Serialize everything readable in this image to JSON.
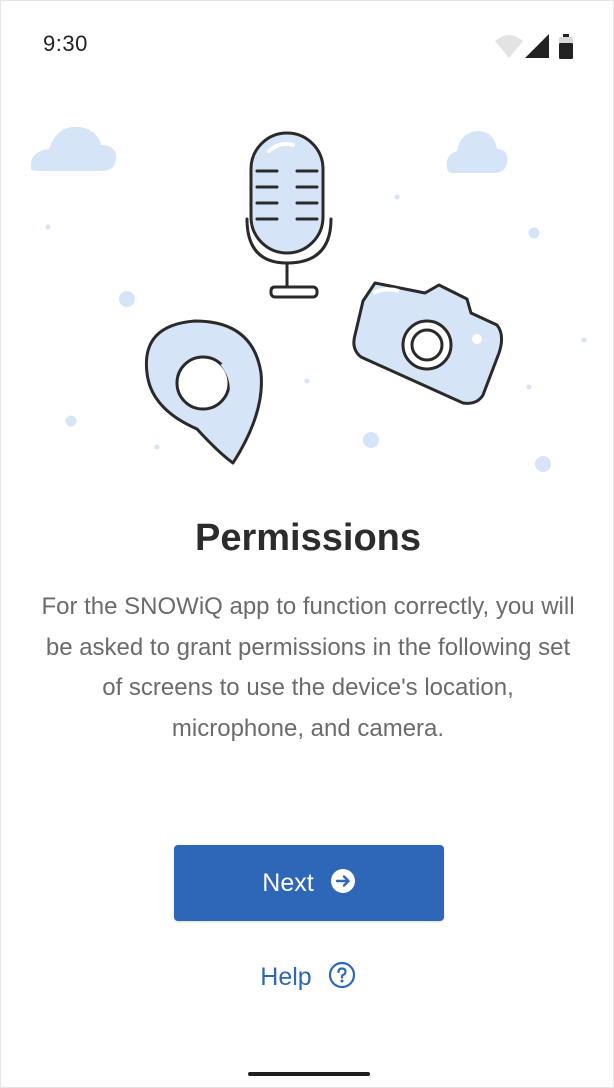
{
  "status_bar": {
    "time": "9:30",
    "icons": [
      "wifi-icon",
      "cellular-signal-icon",
      "battery-icon"
    ]
  },
  "illustration": {
    "items": [
      "microphone-icon",
      "camera-icon",
      "location-pin-icon",
      "cloud-icon"
    ]
  },
  "main": {
    "title": "Permissions",
    "description": "For the SNOWiQ app to function correctly, you will be asked to grant permissions in the following set of screens to use the device's location, microphone, and camera.",
    "next_label": "Next",
    "help_label": "Help"
  },
  "colors": {
    "accent": "#2f67b8",
    "illustration_fill": "#d6e4f8",
    "illustration_stroke": "#2a2a2a",
    "title": "#2c2c2c",
    "body_text": "#6b6b6b"
  }
}
